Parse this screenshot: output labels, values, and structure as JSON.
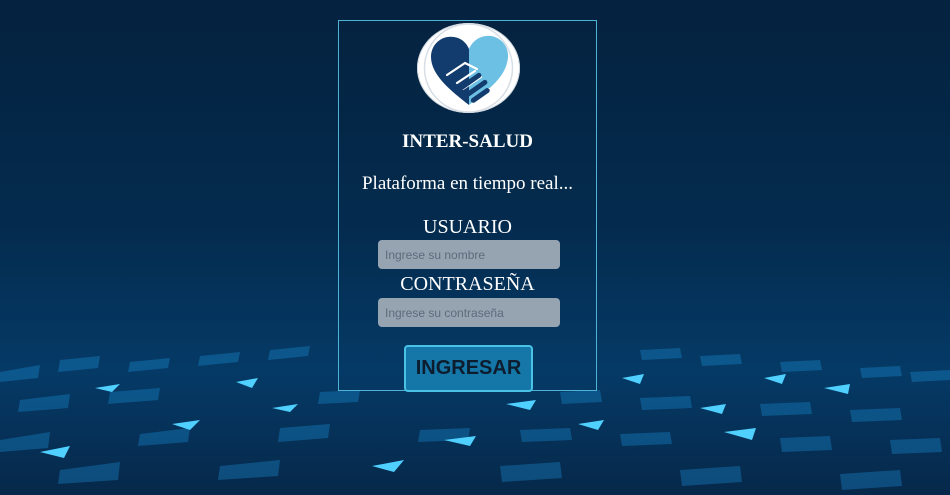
{
  "app": {
    "title": "INTER-SALUD",
    "tagline": "Plataforma en tiempo real..."
  },
  "form": {
    "username": {
      "label": "USUARIO",
      "placeholder": "Ingrese su nombre",
      "value": ""
    },
    "password": {
      "label": "CONTRASEÑA",
      "placeholder": "Ingrese su contraseña",
      "value": ""
    },
    "submit_label": "INGRESAR"
  },
  "logo": {
    "icon": "handshake-heart-icon"
  },
  "colors": {
    "background": "#042b4e",
    "card_border": "#4fb3d6",
    "input_bg": "#96a4b2",
    "button_bg": "#1576a8",
    "button_border": "#49c2e6",
    "logo_dark": "#123b6e",
    "logo_light": "#6cc0e4"
  }
}
